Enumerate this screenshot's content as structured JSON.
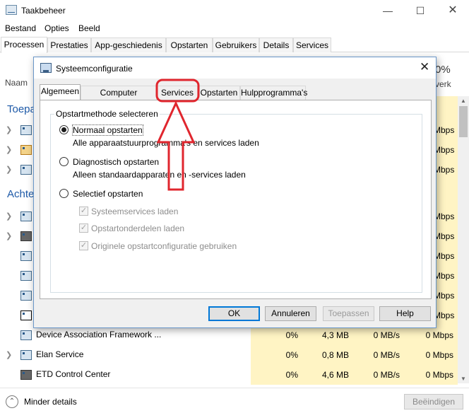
{
  "taskmanager": {
    "title": "Taakbeheer",
    "menu": [
      "Bestand",
      "Opties",
      "Beeld"
    ],
    "tabs": [
      "Processen",
      "Prestaties",
      "App-geschiedenis",
      "Opstarten",
      "Gebruikers",
      "Details",
      "Services"
    ],
    "col_name": "Naam",
    "col_cpu_pct": "0%",
    "col_net_partial": "verk",
    "sections": {
      "apps": "Toepa",
      "background": "Achte"
    },
    "mbps_visible": [
      "Mbps",
      "Mbps",
      "Mbps",
      "Mbps",
      "Mbps",
      "Mbps",
      "Mbps",
      "Mbps",
      "Mbps"
    ],
    "rows": [
      {
        "name": "Device Association Framework ...",
        "cpu": "0%",
        "mem": "4,3 MB",
        "disk": "0 MB/s",
        "net": "0 Mbps"
      },
      {
        "name": "Elan Service",
        "cpu": "0%",
        "mem": "0,8 MB",
        "disk": "0 MB/s",
        "net": "0 Mbps"
      },
      {
        "name": "ETD Control Center",
        "cpu": "0%",
        "mem": "4,6 MB",
        "disk": "0 MB/s",
        "net": "0 Mbps"
      }
    ],
    "footer": {
      "less_details": "Minder details",
      "end_task": "Beëindigen"
    }
  },
  "dialog": {
    "title": "Systeemconfiguratie",
    "tabs": [
      "Algemeen",
      "Computer opstarten",
      "Services",
      "Opstarten",
      "Hulpprogramma's"
    ],
    "group_label": "Opstartmethode selecteren",
    "options": [
      {
        "label": "Normaal opstarten",
        "desc": "Alle apparaatstuurprogramma's en services laden",
        "selected": true
      },
      {
        "label": "Diagnostisch opstarten",
        "desc": "Alleen standaardapparaten en -services laden",
        "selected": false
      },
      {
        "label": "Selectief opstarten",
        "desc": "",
        "selected": false
      }
    ],
    "checkboxes": [
      "Systeemservices laden",
      "Opstartonderdelen laden",
      "Originele opstartconfiguratie gebruiken"
    ],
    "buttons": {
      "ok": "OK",
      "cancel": "Annuleren",
      "apply": "Toepassen",
      "help": "Help"
    }
  },
  "colors": {
    "annotation": "#e0262e",
    "heat": "#fff4c4",
    "accent": "#0078d7"
  }
}
